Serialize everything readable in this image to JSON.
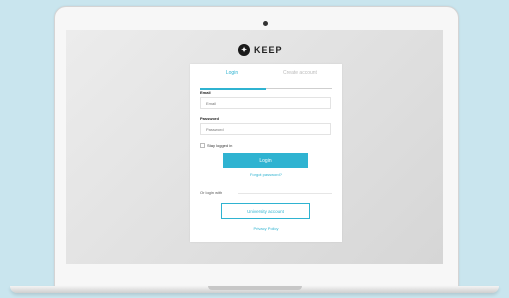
{
  "brand": {
    "name": "KEEP",
    "logo_icon": "keep-logo-icon"
  },
  "tabs": [
    {
      "label": "Login",
      "active": true
    },
    {
      "label": "Create account",
      "active": false
    }
  ],
  "form": {
    "email_label": "Email",
    "email_placeholder": "Email",
    "password_label": "Password",
    "password_placeholder": "Password",
    "stay_logged_in": "Stay logged in",
    "login_button": "Login",
    "forgot_link": "Forgot password?",
    "or_label": "Or login with",
    "university_button": "University account",
    "privacy_link": "Privacy Policy"
  },
  "colors": {
    "accent": "#2fb3d1",
    "background": "#c9e5ee"
  }
}
